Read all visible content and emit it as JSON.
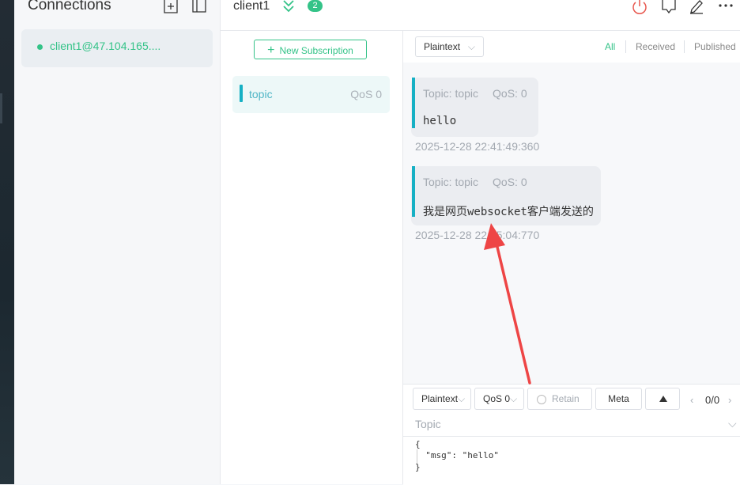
{
  "sidebar": {
    "title": "Connections",
    "connections": [
      {
        "name": "client1@47.104.165....",
        "status": "connected"
      }
    ]
  },
  "header": {
    "client_name": "client1",
    "subscription_count": "2"
  },
  "subscriptions": {
    "new_button": "New Subscription",
    "items": [
      {
        "topic": "topic",
        "qos": "QoS 0",
        "color": "#16b0c4"
      }
    ]
  },
  "messages": {
    "format": "Plaintext",
    "filters": {
      "all": "All",
      "received": "Received",
      "published": "Published"
    },
    "items": [
      {
        "topic": "Topic: topic",
        "qos": "QoS: 0",
        "payload": "hello",
        "time": "2025-12-28 22:41:49:360"
      },
      {
        "topic": "Topic: topic",
        "qos": "QoS: 0",
        "payload": "我是网页websocket客户端发送的",
        "time": "2025-12-28 22:45:04:770"
      }
    ]
  },
  "composer": {
    "format": "Plaintext",
    "qos": "QoS 0",
    "retain": "Retain",
    "meta": "Meta",
    "pager": "0/0",
    "topic_placeholder": "Topic",
    "payload_lines": [
      "{",
      "  \"msg\": \"hello\"",
      "}"
    ]
  },
  "colors": {
    "accent": "#34c388",
    "topic_bar": "#16b0c4",
    "disconnect": "#e8584f",
    "annotation_arrow": "#ee4545"
  },
  "icons": [
    "new-connection-icon",
    "toggle-sidebar-icon",
    "collapse-icon",
    "disconnect-icon",
    "chat-icon",
    "edit-icon",
    "more-icon",
    "send-icon"
  ]
}
